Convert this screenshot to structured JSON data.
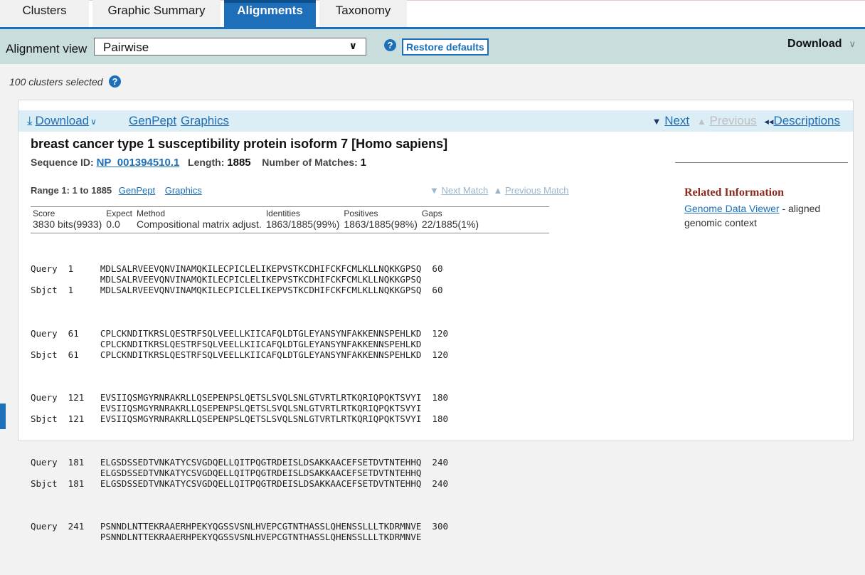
{
  "tabs": [
    "Clusters",
    "Graphic Summary",
    "Alignments",
    "Taxonomy"
  ],
  "toolbar": {
    "view_label": "Alignment view",
    "view_value": "Pairwise",
    "restore_label": "Restore defaults",
    "download_label": "Download"
  },
  "selection": {
    "count_text": "100 clusters selected"
  },
  "result": {
    "download": "Download",
    "genpept": "GenPept",
    "graphics": "Graphics",
    "next": "Next",
    "previous": "Previous",
    "descriptions": "Descriptions",
    "title": "breast cancer type 1 susceptibility protein isoform 7 [Homo sapiens]",
    "seq_id_label": "Sequence ID:",
    "seq_id": "NP_001394510.1",
    "length_label": "Length:",
    "length": "1885",
    "matches_label": "Number of Matches:",
    "matches": "1"
  },
  "range": {
    "label": "Range 1: 1 to 1885",
    "genpept": "GenPept",
    "graphics": "Graphics",
    "next_match": "Next Match",
    "previous_match": "Previous Match"
  },
  "related": {
    "heading": "Related Information",
    "link": "Genome Data Viewer",
    "text": " - aligned genomic context"
  },
  "stats": {
    "headers": [
      "Score",
      "Expect",
      "Method",
      "Identities",
      "Positives",
      "Gaps"
    ],
    "values": [
      "3830 bits(9933)",
      "0.0",
      "Compositional matrix adjust.",
      "1863/1885(99%)",
      "1863/1885(98%)",
      "22/1885(1%)"
    ]
  },
  "alignment": [
    {
      "q": "Query  1     MDLSALRVEEVQNVINAMQKILECPICLELIKEPVSTKCDHIFCKFCMLKLLNQKKGPSQ  60",
      "m": "             MDLSALRVEEVQNVINAMQKILECPICLELIKEPVSTKCDHIFCKFCMLKLLNQKKGPSQ",
      "s": "Sbjct  1     MDLSALRVEEVQNVINAMQKILECPICLELIKEPVSTKCDHIFCKFCMLKLLNQKKGPSQ  60"
    },
    {
      "q": "Query  61    CPLCKNDITKRSLQESTRFSQLVEELLKIICAFQLDTGLEYANSYNFAKKENNSPEHLKD  120",
      "m": "             CPLCKNDITKRSLQESTRFSQLVEELLKIICAFQLDTGLEYANSYNFAKKENNSPEHLKD",
      "s": "Sbjct  61    CPLCKNDITKRSLQESTRFSQLVEELLKIICAFQLDTGLEYANSYNFAKKENNSPEHLKD  120"
    },
    {
      "q": "Query  121   EVSIIQSMGYRNRAKRLLQSEPENPSLQETSLSVQLSNLGTVRTLRTKQRIQPQKTSVYI  180",
      "m": "             EVSIIQSMGYRNRAKRLLQSEPENPSLQETSLSVQLSNLGTVRTLRTKQRIQPQKTSVYI",
      "s": "Sbjct  121   EVSIIQSMGYRNRAKRLLQSEPENPSLQETSLSVQLSNLGTVRTLRTKQRIQPQKTSVYI  180"
    },
    {
      "q": "Query  181   ELGSDSSEDTVNKATYCSVGDQELLQITPQGTRDEISLDSAKKAACEFSETDVTNTEHHQ  240",
      "m": "             ELGSDSSEDTVNKATYCSVGDQELLQITPQGTRDEISLDSAKKAACEFSETDVTNTEHHQ",
      "s": "Sbjct  181   ELGSDSSEDTVNKATYCSVGDQELLQITPQGTRDEISLDSAKKAACEFSETDVTNTEHHQ  240"
    },
    {
      "q": "Query  241   PSNNDLNTTEKRAAERHPEKYQGSSVSNLHVEPCGTNTHASSLQHENSSLLLTKDRMNVE  300",
      "m": "             PSNNDLNTTEKRAAERHPEKYQGSSVSNLHVEPCGTNTHASSLQHENSSLLLTKDRMNVE",
      "s": ""
    }
  ]
}
